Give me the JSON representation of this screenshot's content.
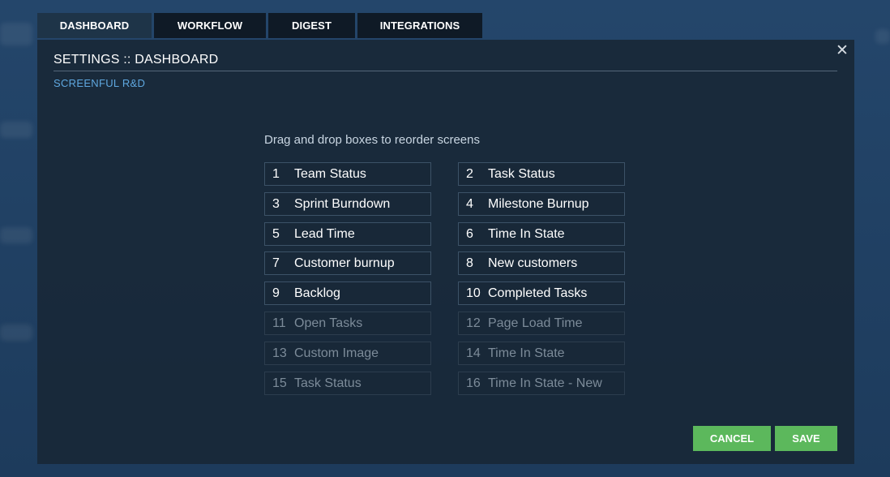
{
  "tabs": [
    {
      "label": "DASHBOARD",
      "active": true
    },
    {
      "label": "WORKFLOW",
      "active": false
    },
    {
      "label": "DIGEST",
      "active": false
    },
    {
      "label": "INTEGRATIONS",
      "active": false
    }
  ],
  "modal": {
    "title": "SETTINGS :: DASHBOARD",
    "subtitle": "SCREENFUL R&D",
    "instruction": "Drag and drop boxes to reorder screens",
    "close_icon": "close-icon"
  },
  "screens": [
    {
      "num": "1",
      "label": "Team Status",
      "enabled": true
    },
    {
      "num": "2",
      "label": "Task Status",
      "enabled": true
    },
    {
      "num": "3",
      "label": "Sprint Burndown",
      "enabled": true
    },
    {
      "num": "4",
      "label": "Milestone Burnup",
      "enabled": true
    },
    {
      "num": "5",
      "label": "Lead Time",
      "enabled": true
    },
    {
      "num": "6",
      "label": "Time In State",
      "enabled": true
    },
    {
      "num": "7",
      "label": "Customer burnup",
      "enabled": true
    },
    {
      "num": "8",
      "label": "New customers",
      "enabled": true
    },
    {
      "num": "9",
      "label": "Backlog",
      "enabled": true
    },
    {
      "num": "10",
      "label": "Completed Tasks",
      "enabled": true
    },
    {
      "num": "11",
      "label": "Open Tasks",
      "enabled": false
    },
    {
      "num": "12",
      "label": "Page Load Time",
      "enabled": false
    },
    {
      "num": "13",
      "label": "Custom Image",
      "enabled": false
    },
    {
      "num": "14",
      "label": "Time In State",
      "enabled": false
    },
    {
      "num": "15",
      "label": "Task Status",
      "enabled": false
    },
    {
      "num": "16",
      "label": "Time In State - New",
      "enabled": false
    }
  ],
  "buttons": {
    "cancel": "CANCEL",
    "save": "SAVE"
  },
  "colors": {
    "accent": "#5cb85c",
    "link": "#5fa8e0",
    "tab_bg": "#0f1a26"
  }
}
